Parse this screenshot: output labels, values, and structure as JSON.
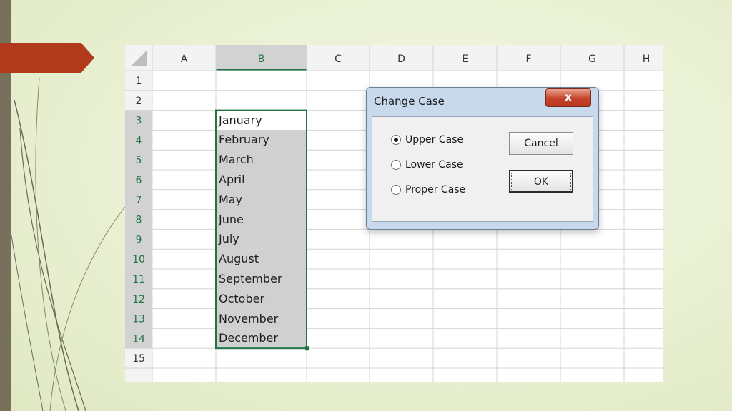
{
  "spreadsheet": {
    "columns": [
      "A",
      "B",
      "C",
      "D",
      "E",
      "F",
      "G",
      "H"
    ],
    "rows": [
      "1",
      "2",
      "3",
      "4",
      "5",
      "6",
      "7",
      "8",
      "9",
      "10",
      "11",
      "12",
      "13",
      "14",
      "15"
    ],
    "column_b_values": [
      "January",
      "February",
      "March",
      "April",
      "May",
      "June",
      "July",
      "August",
      "September",
      "October",
      "November",
      "December"
    ]
  },
  "dialog": {
    "title": "Change Case",
    "close_label": "x",
    "options": [
      "Upper Case",
      "Lower Case",
      "Proper Case"
    ],
    "selected_option": "Upper Case",
    "cancel_label": "Cancel",
    "ok_label": "OK"
  },
  "colors": {
    "arrow": "#b23a1c",
    "selection_fill": "#d0d0d0",
    "selection_border": "#217346",
    "header_selected": "#d2d2d2",
    "gridline": "#d4d4d4"
  }
}
